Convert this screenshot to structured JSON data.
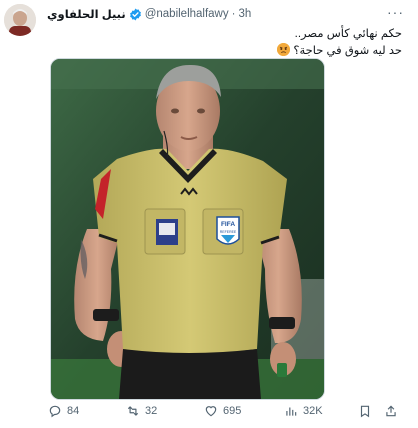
{
  "user": {
    "display_name": "نبيل الحلفاوي",
    "handle": "@nabilelhalfawy",
    "time": "3h"
  },
  "tweet": {
    "line1": "حكم نهائي كأس مصر..",
    "line2": "حد ليه شوق في حاجة؟"
  },
  "photo": {
    "badge_fifa": "FIFA",
    "badge_referee": "REFEREE"
  },
  "stats": {
    "replies": "84",
    "reposts": "32",
    "likes": "695",
    "views": "32K"
  },
  "colors": {
    "shirt": "#c9bd6a",
    "background": "#2a4430",
    "verified": "#1d9bf0"
  }
}
